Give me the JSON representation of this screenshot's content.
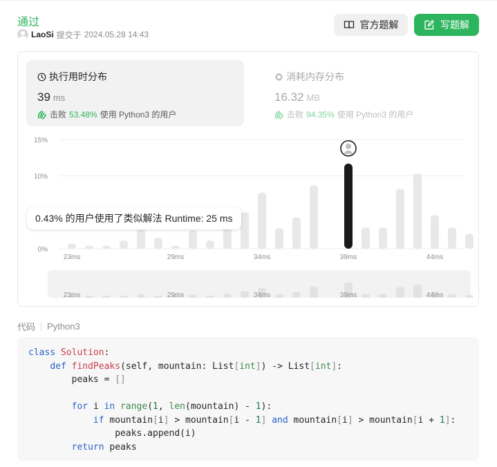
{
  "header": {
    "status": "通过",
    "user": "LaoSi",
    "submitted_prefix": "提交于",
    "submitted_at": "2024.05.28 14:43",
    "official_button": "官方题解",
    "write_button": "写题解"
  },
  "runtime": {
    "title": "执行用时分布",
    "value": "39",
    "unit": "ms",
    "beat_prefix": "击败",
    "beat_percent": "53.48%",
    "beat_suffix": "使用 Python3 的用户"
  },
  "memory": {
    "title": "消耗内存分布",
    "value": "16.32",
    "unit": "MB",
    "beat_prefix": "击败",
    "beat_percent": "94.35%",
    "beat_suffix": "使用 Python3 的用户"
  },
  "tooltip": "0.43% 的用户使用了类似解法 Runtime: 25 ms",
  "chart_data": {
    "type": "bar",
    "yticks": [
      "15%",
      "10%",
      "0%"
    ],
    "ylim": [
      0,
      15
    ],
    "xticks": [
      {
        "label": "23ms",
        "x": 23
      },
      {
        "label": "29ms",
        "x": 29
      },
      {
        "label": "34ms",
        "x": 34
      },
      {
        "label": "39ms",
        "x": 39
      },
      {
        "label": "44ms",
        "x": 44
      }
    ],
    "x": [
      23,
      24,
      25,
      26,
      27,
      28,
      29,
      30,
      31,
      32,
      33,
      34,
      35,
      36,
      37,
      38,
      39,
      40,
      41,
      42,
      43,
      44,
      45,
      46
    ],
    "values": [
      0.7,
      0.4,
      0.4,
      1.1,
      2.6,
      1.5,
      0.4,
      2.5,
      1.1,
      3.0,
      5.0,
      7.7,
      2.8,
      4.3,
      8.7,
      0,
      11.7,
      2.9,
      2.9,
      8.2,
      10.3,
      4.6,
      2.9,
      2.0
    ],
    "highlight_x": 39,
    "grid": true,
    "colors": {
      "bar": "#e8e8e8",
      "highlight": "#1a1a1a",
      "grid": "#eeeeee"
    },
    "overview_xticks": [
      "23ms",
      "29ms",
      "34ms",
      "39ms",
      "44ms"
    ]
  },
  "code": {
    "label": "代码",
    "language": "Python3",
    "lines": [
      [
        {
          "t": "class ",
          "c": "kw"
        },
        {
          "t": "Solution",
          "c": "cls"
        },
        {
          "t": ":",
          "c": ""
        }
      ],
      [
        {
          "t": "    ",
          "c": ""
        },
        {
          "t": "def ",
          "c": "kw"
        },
        {
          "t": "findPeaks",
          "c": "fn"
        },
        {
          "t": "(self, mountain: List",
          "c": ""
        },
        {
          "t": "[",
          "c": "op"
        },
        {
          "t": "int",
          "c": "ty"
        },
        {
          "t": "]",
          "c": "op"
        },
        {
          "t": ") -> List",
          "c": ""
        },
        {
          "t": "[",
          "c": "op"
        },
        {
          "t": "int",
          "c": "ty"
        },
        {
          "t": "]",
          "c": "op"
        },
        {
          "t": ":",
          "c": ""
        }
      ],
      [
        {
          "t": "        peaks = ",
          "c": ""
        },
        {
          "t": "[]",
          "c": "op"
        }
      ],
      [
        {
          "t": "",
          "c": ""
        }
      ],
      [
        {
          "t": "        ",
          "c": ""
        },
        {
          "t": "for ",
          "c": "kw"
        },
        {
          "t": "i ",
          "c": ""
        },
        {
          "t": "in ",
          "c": "kw"
        },
        {
          "t": "range",
          "c": "ty"
        },
        {
          "t": "(",
          "c": ""
        },
        {
          "t": "1",
          "c": "num"
        },
        {
          "t": ", ",
          "c": ""
        },
        {
          "t": "len",
          "c": "ty"
        },
        {
          "t": "(mountain) - ",
          "c": ""
        },
        {
          "t": "1",
          "c": "num"
        },
        {
          "t": "):",
          "c": ""
        }
      ],
      [
        {
          "t": "            ",
          "c": ""
        },
        {
          "t": "if ",
          "c": "kw"
        },
        {
          "t": "mountain",
          "c": ""
        },
        {
          "t": "[",
          "c": "op"
        },
        {
          "t": "i",
          "c": ""
        },
        {
          "t": "]",
          "c": "op"
        },
        {
          "t": " > mountain",
          "c": ""
        },
        {
          "t": "[",
          "c": "op"
        },
        {
          "t": "i - ",
          "c": ""
        },
        {
          "t": "1",
          "c": "num"
        },
        {
          "t": "]",
          "c": "op"
        },
        {
          "t": " ",
          "c": ""
        },
        {
          "t": "and ",
          "c": "kw"
        },
        {
          "t": "mountain",
          "c": ""
        },
        {
          "t": "[",
          "c": "op"
        },
        {
          "t": "i",
          "c": ""
        },
        {
          "t": "]",
          "c": "op"
        },
        {
          "t": " > mountain",
          "c": ""
        },
        {
          "t": "[",
          "c": "op"
        },
        {
          "t": "i + ",
          "c": ""
        },
        {
          "t": "1",
          "c": "num"
        },
        {
          "t": "]",
          "c": "op"
        },
        {
          "t": ":",
          "c": ""
        }
      ],
      [
        {
          "t": "                peaks.append(i)",
          "c": ""
        }
      ],
      [
        {
          "t": "        ",
          "c": ""
        },
        {
          "t": "return ",
          "c": "kw"
        },
        {
          "t": "peaks",
          "c": ""
        }
      ]
    ]
  }
}
